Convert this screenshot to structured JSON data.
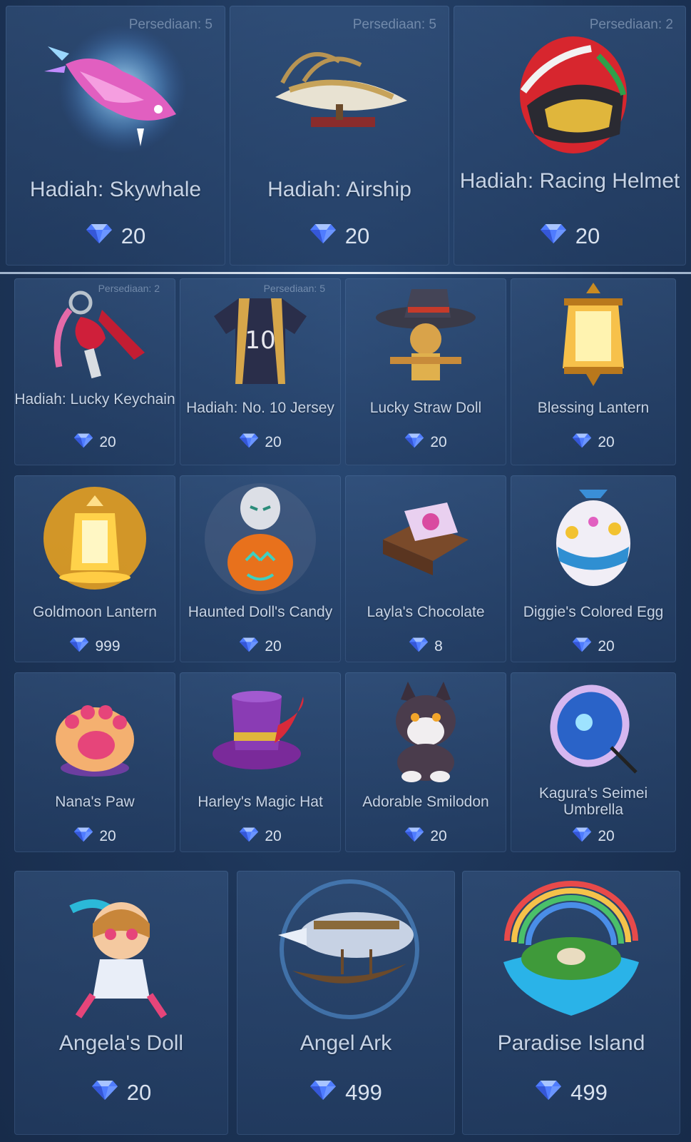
{
  "currency_icon": "diamond-icon",
  "colors": {
    "background": "#1e3659",
    "card": "#2b4874",
    "text": "#c6d3e6",
    "gem": "#4f7cff"
  },
  "top_row": [
    {
      "id": "skywhale",
      "name": "Hadiah: Skywhale",
      "stock": "Persediaan: 5",
      "price": "20",
      "icon": "skywhale-icon"
    },
    {
      "id": "airship",
      "name": "Hadiah: Airship",
      "stock": "Persediaan: 5",
      "price": "20",
      "icon": "airship-icon"
    },
    {
      "id": "racing-helmet",
      "name": "Hadiah: Racing Helmet",
      "stock": "Persediaan: 2",
      "price": "20",
      "icon": "racing-helmet-icon"
    }
  ],
  "grid": [
    {
      "id": "lucky-keychain",
      "name": "Hadiah: Lucky Keychain",
      "stock": "Persediaan: 2",
      "price": "20",
      "icon": "keychain-icon"
    },
    {
      "id": "no10-jersey",
      "name": "Hadiah: No. 10 Jersey",
      "stock": "Persediaan: 5",
      "price": "20",
      "icon": "jersey-icon"
    },
    {
      "id": "lucky-straw-doll",
      "name": "Lucky Straw Doll",
      "stock": "",
      "price": "20",
      "icon": "straw-doll-icon"
    },
    {
      "id": "blessing-lantern",
      "name": "Blessing Lantern",
      "stock": "",
      "price": "20",
      "icon": "lantern-icon"
    },
    {
      "id": "goldmoon-lantern",
      "name": "Goldmoon Lantern",
      "stock": "",
      "price": "999",
      "icon": "gold-lantern-icon"
    },
    {
      "id": "haunted-dolls-candy",
      "name": "Haunted Doll's Candy",
      "stock": "",
      "price": "20",
      "icon": "pumpkin-icon"
    },
    {
      "id": "laylas-chocolate",
      "name": "Layla's Chocolate",
      "stock": "",
      "price": "8",
      "icon": "chocolate-icon"
    },
    {
      "id": "diggies-colored-egg",
      "name": "Diggie's Colored Egg",
      "stock": "",
      "price": "20",
      "icon": "egg-icon"
    },
    {
      "id": "nanas-paw",
      "name": "Nana's Paw",
      "stock": "",
      "price": "20",
      "icon": "paw-icon"
    },
    {
      "id": "harleys-magic-hat",
      "name": "Harley's Magic Hat",
      "stock": "",
      "price": "20",
      "icon": "magic-hat-icon"
    },
    {
      "id": "adorable-smilodon",
      "name": "Adorable Smilodon",
      "stock": "",
      "price": "20",
      "icon": "smilodon-icon"
    },
    {
      "id": "kaguras-seimei-umbrella",
      "name": "Kagura's Seimei Umbrella",
      "stock": "",
      "price": "20",
      "icon": "umbrella-icon"
    }
  ],
  "bottom_row": [
    {
      "id": "angelas-doll",
      "name": "Angela's Doll",
      "stock": "",
      "price": "20",
      "icon": "angela-doll-icon"
    },
    {
      "id": "angel-ark",
      "name": "Angel Ark",
      "stock": "",
      "price": "499",
      "icon": "angel-ark-icon"
    },
    {
      "id": "paradise-island",
      "name": "Paradise Island",
      "stock": "",
      "price": "499",
      "icon": "paradise-island-icon"
    }
  ]
}
